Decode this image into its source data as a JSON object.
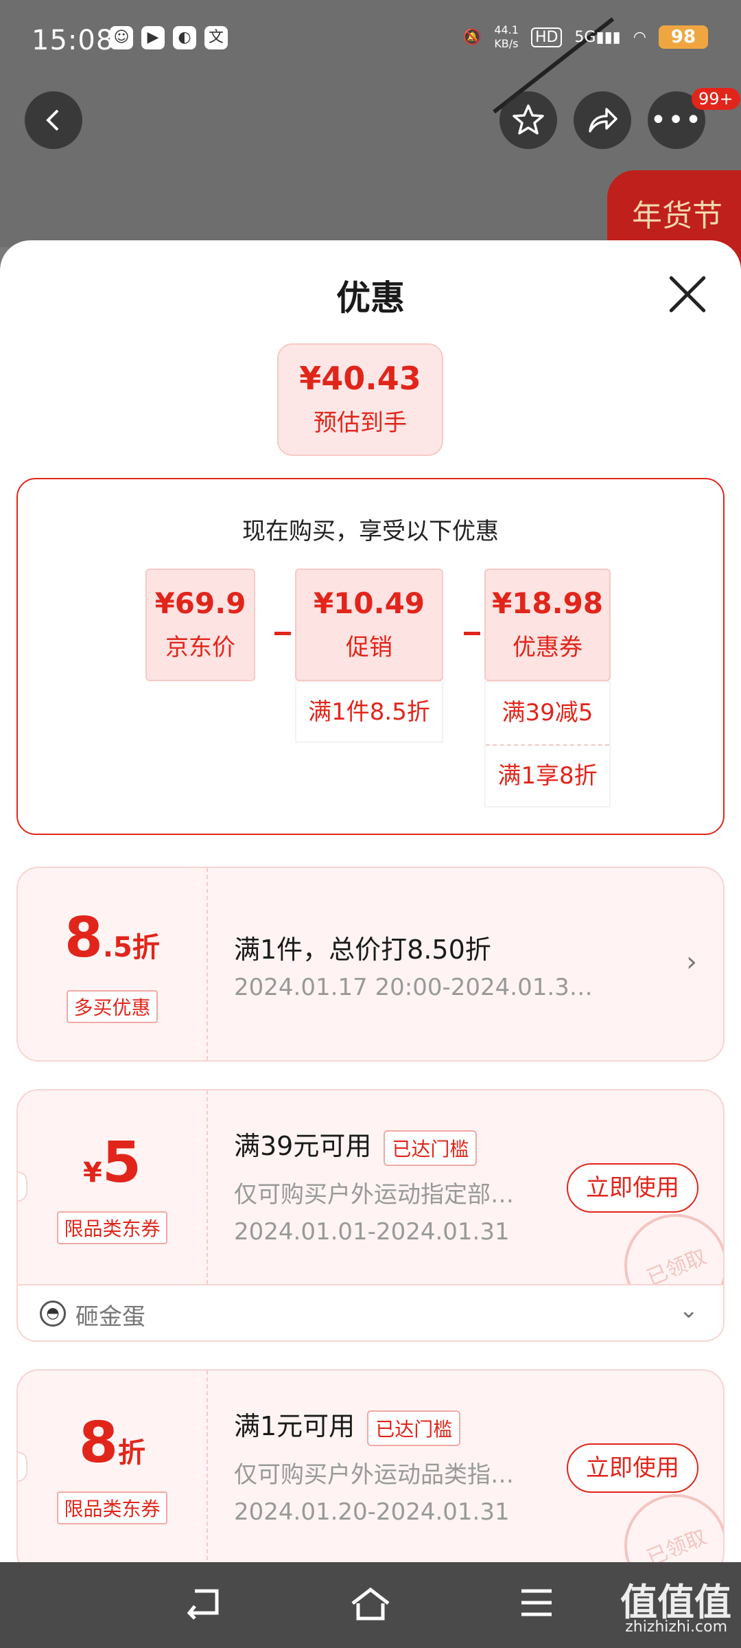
{
  "status": {
    "time": "15:08",
    "speed": "44.1\nKB/s",
    "net": "5G",
    "battery": "98"
  },
  "topbar": {
    "badge": "99+",
    "deco_text": "年货节"
  },
  "sheet": {
    "title": "优惠",
    "estimate": {
      "price": "¥40.43",
      "label": "预估到手"
    },
    "breakdown": {
      "title": "现在购买，享受以下优惠",
      "items": [
        {
          "value": "¥69.9",
          "label": "京东价"
        },
        {
          "value": "¥10.49",
          "label": "促销",
          "details": [
            "满1件8.5折"
          ]
        },
        {
          "value": "¥18.98",
          "label": "优惠券",
          "details": [
            "满39减5",
            "满1享8折"
          ]
        }
      ]
    },
    "cards": [
      {
        "big": "8",
        "small": ".5折",
        "tag": "多买优惠",
        "title": "满1件，总价打8.50折",
        "sub": "2024.01.17 20:00-2024.01.3…"
      },
      {
        "prefix": "¥",
        "big": "5",
        "tag": "限品类东券",
        "title": "满39元可用",
        "reach": "已达门槛",
        "desc": "仅可购买户外运动指定部…",
        "date": "2024.01.01-2024.01.31",
        "button": "立即使用",
        "stamp": "已领取",
        "egg": "砸金蛋"
      },
      {
        "big": "8",
        "suffix": "折",
        "tag": "限品类东券",
        "title": "满1元可用",
        "reach": "已达门槛",
        "desc": "仅可购买户外运动品类指…",
        "date": "2024.01.20-2024.01.31",
        "button": "立即使用",
        "stamp": "已领取"
      }
    ]
  },
  "watermark": {
    "main": "值值值",
    "sub": "zhizhizhi.com"
  }
}
